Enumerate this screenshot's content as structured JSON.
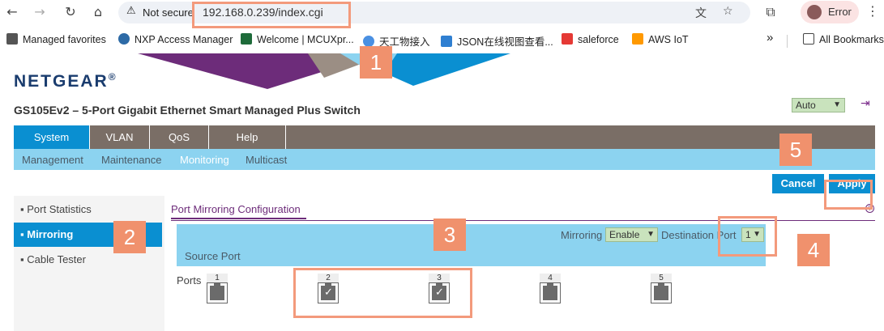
{
  "browser": {
    "back_icon": "←",
    "forward_icon": "→",
    "reload_icon": "↻",
    "home_icon": "⌂",
    "warning_icon": "⚠",
    "not_secure": "Not secure",
    "url": "192.168.0.239/index.cgi",
    "translate_icon": "文",
    "star_icon": "☆",
    "extensions_icon": "⧉",
    "profile_label": "Error",
    "menu_icon": "⋮"
  },
  "bookmarks": {
    "items": [
      {
        "label": "Managed favorites",
        "color": "#555555"
      },
      {
        "label": "NXP Access Manager",
        "color": "#2d6aa6"
      },
      {
        "label": "Welcome | MCUXpr...",
        "color": "#1e6b3a"
      },
      {
        "label": "天工物接入",
        "color": "#4a90e2"
      },
      {
        "label": "JSON在线视图查看...",
        "color": "#2f7fd1"
      },
      {
        "label": "saleforce",
        "color": "#e53935"
      },
      {
        "label": "AWS IoT",
        "color": "#ff9900"
      }
    ],
    "more_icon": "»",
    "all_bookmarks": "All Bookmarks"
  },
  "header": {
    "logo": "NETGEAR",
    "logo_mark": "®",
    "model": "GS105Ev2 – 5-Port Gigabit Ethernet Smart Managed Plus Switch",
    "language_value": "Auto",
    "logout_icon": "⇥"
  },
  "nav": {
    "tabs": [
      "System",
      "VLAN",
      "QoS",
      "Help"
    ],
    "active_tab": "System",
    "subtabs": [
      "Management",
      "Maintenance",
      "Monitoring",
      "Multicast"
    ],
    "active_subtab": "Monitoring"
  },
  "actions": {
    "cancel": "Cancel",
    "apply": "Apply"
  },
  "sidebar": {
    "items": [
      "Port Statistics",
      "Mirroring",
      "Cable Tester"
    ],
    "active": "Mirroring"
  },
  "content": {
    "section_title": "Port Mirroring Configuration",
    "help_icon": "?",
    "mirroring_label": "Mirroring",
    "mirroring_value": "Enable",
    "destination_label": "Destination Port",
    "destination_value": "1",
    "source_port_label": "Source Port",
    "ports_label": "Ports",
    "ports": [
      {
        "num": "1",
        "checked": false
      },
      {
        "num": "2",
        "checked": true
      },
      {
        "num": "3",
        "checked": true
      },
      {
        "num": "4",
        "checked": false
      },
      {
        "num": "5",
        "checked": false
      }
    ]
  },
  "annotations": [
    "1",
    "2",
    "3",
    "4",
    "5"
  ],
  "colors": {
    "accent_blue": "#0a8fd1",
    "light_blue": "#8cd3f0",
    "menu_gray": "#7a6e66",
    "purple": "#6d2c7a",
    "annotation_orange": "#f0916d"
  }
}
